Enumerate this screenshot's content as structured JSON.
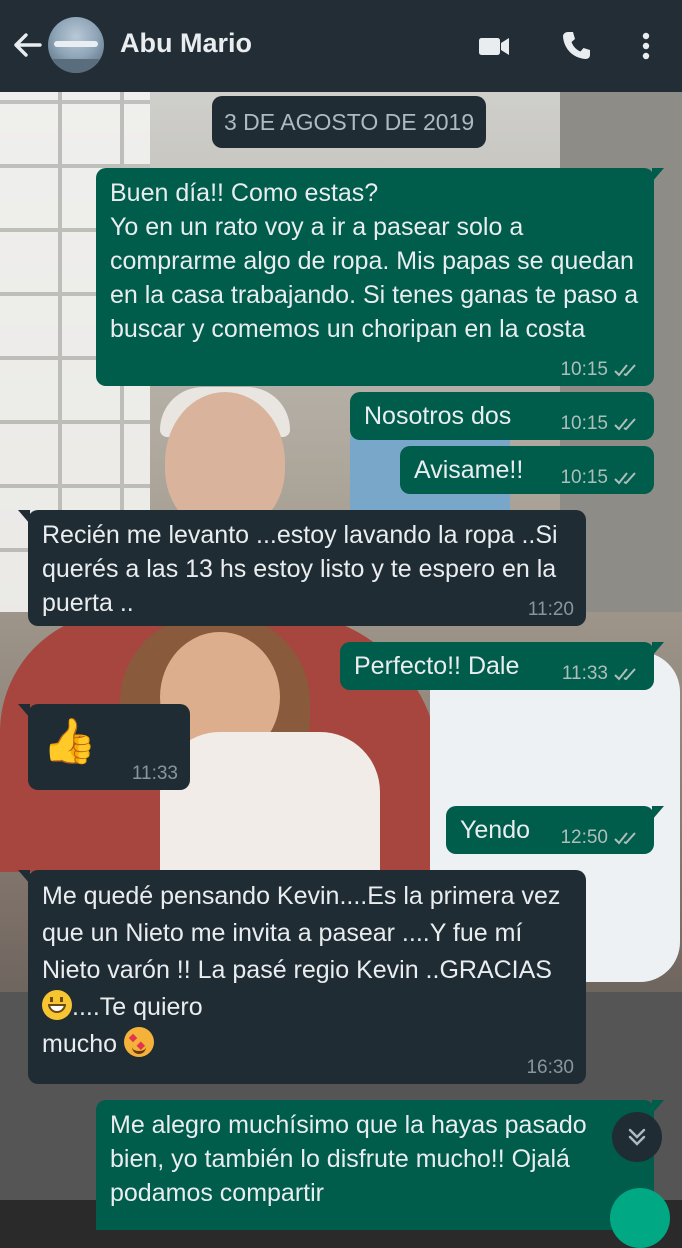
{
  "header": {
    "contact_name": "Abu Mario",
    "icons": [
      "back-arrow-icon",
      "avatar",
      "video-call-icon",
      "phone-icon",
      "more-vert-icon"
    ],
    "bar_color": "#232d36"
  },
  "chat": {
    "date_label": "3 DE AGOSTO DE 2019",
    "colors": {
      "outgoing": "#005c4b",
      "incoming": "#202c33",
      "text": "#e9edef"
    },
    "messages": [
      {
        "dir": "out",
        "text": "Buen día!! Como estas?\nYo en un rato voy a ir a pasear solo a comprarme algo de ropa. Mis papas se quedan en la casa trabajando. Si tenes ganas te paso a buscar y comemos un choripan en la costa",
        "time": "10:15",
        "status": "read"
      },
      {
        "dir": "out",
        "text": "Nosotros dos",
        "time": "10:15",
        "status": "read"
      },
      {
        "dir": "out",
        "text": "Avisame!!",
        "time": "10:15",
        "status": "read"
      },
      {
        "dir": "in",
        "text": "Recién me levanto ...estoy lavando la ropa ..Si querés a las 13 hs estoy listo y te espero en la puerta ..",
        "time": "11:20"
      },
      {
        "dir": "out",
        "text": "Perfecto!! Dale",
        "time": "11:33",
        "status": "read"
      },
      {
        "dir": "in",
        "text": "👍",
        "time": "11:33"
      },
      {
        "dir": "out",
        "text": "Yendo",
        "time": "12:50",
        "status": "read"
      },
      {
        "dir": "in",
        "text_a": "Me quedé pensando Kevin....Es la primera vez que un Nieto me invita a pasear ....Y fue mí Nieto varón !! La pasé regio Kevin ..GRACIAS ",
        "text_b": "....Te quiero",
        "text_c": "mucho ",
        "time": "16:30"
      },
      {
        "dir": "out",
        "text": "Me alegro muchísimo que la hayas pasado bien, yo también lo disfrute mucho!! Ojalá podamos compartir"
      }
    ]
  },
  "scroll_button_icon": "double-chevron-down-icon"
}
